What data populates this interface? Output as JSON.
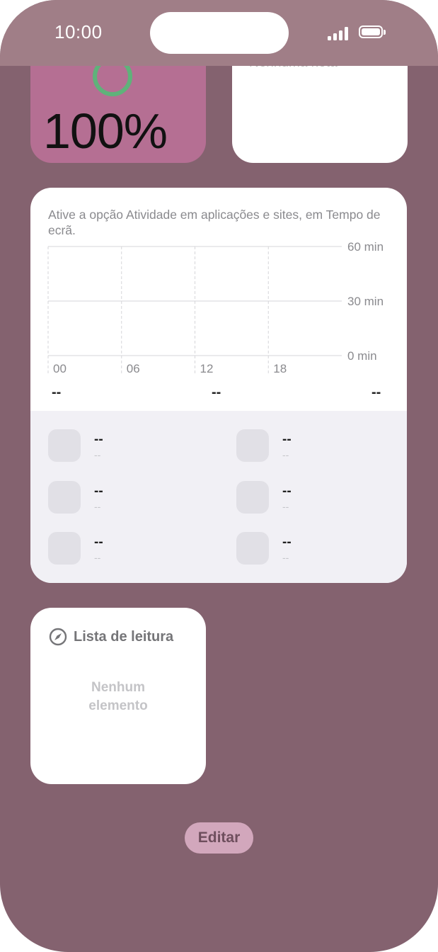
{
  "status_bar": {
    "time": "10:00"
  },
  "battery_widget": {
    "percentage": "100%",
    "level": 1.0
  },
  "notes_widget": {
    "empty_text": "Nenhuma nota"
  },
  "screen_time_widget": {
    "message": "Ative a opção Atividade em aplicações e sites, em Tempo de ecrã.",
    "chart_data": {
      "type": "bar",
      "x_ticks": [
        "00",
        "06",
        "12",
        "18"
      ],
      "y_ticks": [
        "60 min",
        "30 min",
        "0 min"
      ],
      "ylim": [
        0,
        60
      ],
      "values": []
    },
    "totals": [
      "--",
      "--",
      "--"
    ],
    "apps": [
      {
        "name": "--",
        "time": "--"
      },
      {
        "name": "--",
        "time": "--"
      },
      {
        "name": "--",
        "time": "--"
      },
      {
        "name": "--",
        "time": "--"
      },
      {
        "name": "--",
        "time": "--"
      },
      {
        "name": "--",
        "time": "--"
      }
    ]
  },
  "reading_list_widget": {
    "title": "Lista de leitura",
    "icon": "compass-icon",
    "empty_text_line1": "Nenhum",
    "empty_text_line2": "elemento"
  },
  "edit_button": {
    "label": "Editar"
  }
}
